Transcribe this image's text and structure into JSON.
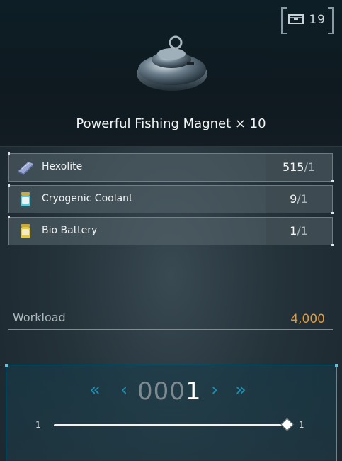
{
  "inventory": {
    "icon": "inventory-box-icon",
    "count": "19"
  },
  "item": {
    "icon": "fishing-magnet-icon",
    "name": "Powerful Fishing Magnet",
    "quantity_text": "× 10"
  },
  "materials": [
    {
      "icon": "hexolite-ingot-icon",
      "name": "Hexolite",
      "have": "515",
      "need": "1"
    },
    {
      "icon": "cryogenic-coolant-icon",
      "name": "Cryogenic Coolant",
      "have": "9",
      "need": "1"
    },
    {
      "icon": "bio-battery-icon",
      "name": "Bio Battery",
      "have": "1",
      "need": "1"
    }
  ],
  "workload": {
    "label": "Workload",
    "value": "4,000"
  },
  "quantity": {
    "leading_zeros": "000",
    "value": "1",
    "min": "1",
    "max": "1",
    "slider_fraction": 1.0
  },
  "colors": {
    "accent": "#1f8fb0",
    "workload": "#e89a30"
  }
}
